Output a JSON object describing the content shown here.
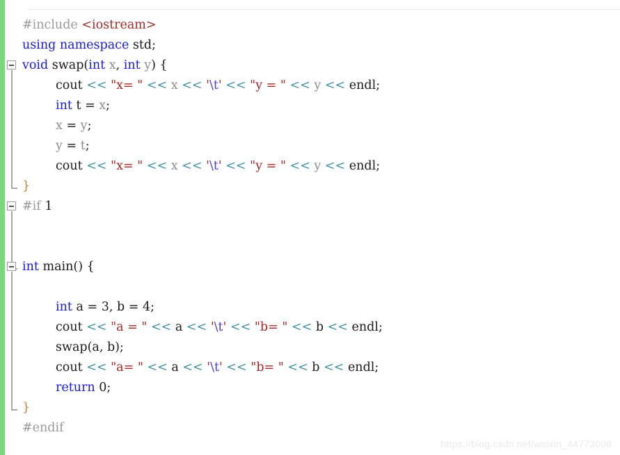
{
  "window": {
    "kind": "code-editor",
    "language": "C++",
    "background": "#ffffff"
  },
  "colors": {
    "change_bar_green": "#7ad87a",
    "preprocessor_gray": "#9a9a9a",
    "include_target_red": "#9c2b2b",
    "keyword_blue": "#1b1bd6",
    "identifier_black": "#1a1a1a",
    "variable_gray": "#8c8c8c",
    "stream_operator_teal": "#3e8fa3",
    "string_red": "#a32626",
    "escape_violet": "#4a3fd0",
    "brace_orange": "#c08030",
    "fold_marker_gray": "#9a9a9a",
    "watermark_gray": "#eaeaea"
  },
  "gutter": {
    "fold_markers": [
      {
        "name": "fold-marker-swap",
        "line": 3,
        "state": "expanded",
        "glyph": "minus"
      },
      {
        "name": "fold-marker-if",
        "line": 9,
        "state": "expanded",
        "glyph": "minus"
      },
      {
        "name": "fold-marker-main",
        "line": 12,
        "state": "expanded",
        "glyph": "minus"
      }
    ]
  },
  "code": {
    "lines": [
      {
        "index": 1,
        "indent": 0,
        "tokens": [
          {
            "t": "#include ",
            "c": "tok-pre"
          },
          {
            "t": "<iostream>",
            "c": "tok-inc"
          }
        ]
      },
      {
        "index": 2,
        "indent": 0,
        "tokens": [
          {
            "t": "using namespace",
            "c": "tok-kw"
          },
          {
            "t": " std;",
            "c": "tok-plain"
          }
        ]
      },
      {
        "index": 3,
        "indent": 0,
        "tokens": [
          {
            "t": "void",
            "c": "tok-kw"
          },
          {
            "t": " swap(",
            "c": "tok-plain"
          },
          {
            "t": "int",
            "c": "tok-kw"
          },
          {
            "t": " x",
            "c": "tok-var"
          },
          {
            "t": ", ",
            "c": "tok-plain"
          },
          {
            "t": "int",
            "c": "tok-kw"
          },
          {
            "t": " y",
            "c": "tok-var"
          },
          {
            "t": ") ",
            "c": "tok-plain"
          },
          {
            "t": "{",
            "c": "tok-plain"
          }
        ]
      },
      {
        "index": 4,
        "indent": 1,
        "tokens": [
          {
            "t": "cout ",
            "c": "tok-plain"
          },
          {
            "t": "<<",
            "c": "tok-op"
          },
          {
            "t": " ",
            "c": "tok-plain"
          },
          {
            "t": "\"x= \"",
            "c": "tok-str"
          },
          {
            "t": " ",
            "c": "tok-plain"
          },
          {
            "t": "<<",
            "c": "tok-op"
          },
          {
            "t": " x ",
            "c": "tok-var"
          },
          {
            "t": "<<",
            "c": "tok-op"
          },
          {
            "t": " ",
            "c": "tok-plain"
          },
          {
            "t": "'",
            "c": "tok-str"
          },
          {
            "t": "\\t",
            "c": "tok-esc"
          },
          {
            "t": "'",
            "c": "tok-str"
          },
          {
            "t": " ",
            "c": "tok-plain"
          },
          {
            "t": "<<",
            "c": "tok-op"
          },
          {
            "t": " ",
            "c": "tok-plain"
          },
          {
            "t": "\"y = \"",
            "c": "tok-str"
          },
          {
            "t": " ",
            "c": "tok-plain"
          },
          {
            "t": "<<",
            "c": "tok-op"
          },
          {
            "t": " y ",
            "c": "tok-var"
          },
          {
            "t": "<<",
            "c": "tok-op"
          },
          {
            "t": " endl;",
            "c": "tok-plain"
          }
        ]
      },
      {
        "index": 5,
        "indent": 1,
        "tokens": [
          {
            "t": "int",
            "c": "tok-kw"
          },
          {
            "t": " t = ",
            "c": "tok-plain"
          },
          {
            "t": "x",
            "c": "tok-var"
          },
          {
            "t": ";",
            "c": "tok-plain"
          }
        ]
      },
      {
        "index": 6,
        "indent": 1,
        "tokens": [
          {
            "t": "x ",
            "c": "tok-var"
          },
          {
            "t": "= ",
            "c": "tok-plain"
          },
          {
            "t": "y",
            "c": "tok-var"
          },
          {
            "t": ";",
            "c": "tok-plain"
          }
        ]
      },
      {
        "index": 7,
        "indent": 1,
        "tokens": [
          {
            "t": "y ",
            "c": "tok-var"
          },
          {
            "t": "= ",
            "c": "tok-plain"
          },
          {
            "t": "t",
            "c": "tok-var"
          },
          {
            "t": ";",
            "c": "tok-plain"
          }
        ]
      },
      {
        "index": 8,
        "indent": 1,
        "tokens": [
          {
            "t": "cout ",
            "c": "tok-plain"
          },
          {
            "t": "<<",
            "c": "tok-op"
          },
          {
            "t": " ",
            "c": "tok-plain"
          },
          {
            "t": "\"x= \"",
            "c": "tok-str"
          },
          {
            "t": " ",
            "c": "tok-plain"
          },
          {
            "t": "<<",
            "c": "tok-op"
          },
          {
            "t": " x ",
            "c": "tok-var"
          },
          {
            "t": "<<",
            "c": "tok-op"
          },
          {
            "t": " ",
            "c": "tok-plain"
          },
          {
            "t": "'",
            "c": "tok-str"
          },
          {
            "t": "\\t",
            "c": "tok-esc"
          },
          {
            "t": "'",
            "c": "tok-str"
          },
          {
            "t": " ",
            "c": "tok-plain"
          },
          {
            "t": "<<",
            "c": "tok-op"
          },
          {
            "t": " ",
            "c": "tok-plain"
          },
          {
            "t": "\"y = \"",
            "c": "tok-str"
          },
          {
            "t": " ",
            "c": "tok-plain"
          },
          {
            "t": "<<",
            "c": "tok-op"
          },
          {
            "t": " y ",
            "c": "tok-var"
          },
          {
            "t": "<<",
            "c": "tok-op"
          },
          {
            "t": " endl;",
            "c": "tok-plain"
          }
        ]
      },
      {
        "index": 9,
        "indent": 0,
        "tokens": [
          {
            "t": "}",
            "c": "tok-brace"
          }
        ]
      },
      {
        "index": 10,
        "indent": 0,
        "tokens": [
          {
            "t": "#if ",
            "c": "tok-pre"
          },
          {
            "t": "1",
            "c": "tok-num"
          }
        ]
      },
      {
        "index": 11,
        "indent": 0,
        "tokens": []
      },
      {
        "index": 12,
        "indent": 0,
        "tokens": []
      },
      {
        "index": 13,
        "indent": 0,
        "tokens": [
          {
            "t": "int",
            "c": "tok-kw"
          },
          {
            "t": " main() ",
            "c": "tok-plain"
          },
          {
            "t": "{",
            "c": "tok-plain"
          }
        ]
      },
      {
        "index": 14,
        "indent": 0,
        "tokens": []
      },
      {
        "index": 15,
        "indent": 1,
        "tokens": [
          {
            "t": "int",
            "c": "tok-kw"
          },
          {
            "t": " a = ",
            "c": "tok-plain"
          },
          {
            "t": "3",
            "c": "tok-num"
          },
          {
            "t": ", b = ",
            "c": "tok-plain"
          },
          {
            "t": "4",
            "c": "tok-num"
          },
          {
            "t": ";",
            "c": "tok-plain"
          }
        ]
      },
      {
        "index": 16,
        "indent": 1,
        "tokens": [
          {
            "t": "cout ",
            "c": "tok-plain"
          },
          {
            "t": "<<",
            "c": "tok-op"
          },
          {
            "t": " ",
            "c": "tok-plain"
          },
          {
            "t": "\"a = \"",
            "c": "tok-str"
          },
          {
            "t": " ",
            "c": "tok-plain"
          },
          {
            "t": "<<",
            "c": "tok-op"
          },
          {
            "t": " a ",
            "c": "tok-plain"
          },
          {
            "t": "<<",
            "c": "tok-op"
          },
          {
            "t": " ",
            "c": "tok-plain"
          },
          {
            "t": "'",
            "c": "tok-str"
          },
          {
            "t": "\\t",
            "c": "tok-esc"
          },
          {
            "t": "'",
            "c": "tok-str"
          },
          {
            "t": " ",
            "c": "tok-plain"
          },
          {
            "t": "<<",
            "c": "tok-op"
          },
          {
            "t": " ",
            "c": "tok-plain"
          },
          {
            "t": "\"b= \"",
            "c": "tok-str"
          },
          {
            "t": " ",
            "c": "tok-plain"
          },
          {
            "t": "<<",
            "c": "tok-op"
          },
          {
            "t": " b ",
            "c": "tok-plain"
          },
          {
            "t": "<<",
            "c": "tok-op"
          },
          {
            "t": " endl;",
            "c": "tok-plain"
          }
        ]
      },
      {
        "index": 17,
        "indent": 1,
        "tokens": [
          {
            "t": "swap(a, b);",
            "c": "tok-plain"
          }
        ]
      },
      {
        "index": 18,
        "indent": 1,
        "tokens": [
          {
            "t": "cout ",
            "c": "tok-plain"
          },
          {
            "t": "<<",
            "c": "tok-op"
          },
          {
            "t": " ",
            "c": "tok-plain"
          },
          {
            "t": "\"a= \"",
            "c": "tok-str"
          },
          {
            "t": " ",
            "c": "tok-plain"
          },
          {
            "t": "<<",
            "c": "tok-op"
          },
          {
            "t": " a ",
            "c": "tok-plain"
          },
          {
            "t": "<<",
            "c": "tok-op"
          },
          {
            "t": " ",
            "c": "tok-plain"
          },
          {
            "t": "'",
            "c": "tok-str"
          },
          {
            "t": "\\t",
            "c": "tok-esc"
          },
          {
            "t": "'",
            "c": "tok-str"
          },
          {
            "t": " ",
            "c": "tok-plain"
          },
          {
            "t": "<<",
            "c": "tok-op"
          },
          {
            "t": " ",
            "c": "tok-plain"
          },
          {
            "t": "\"b= \"",
            "c": "tok-str"
          },
          {
            "t": " ",
            "c": "tok-plain"
          },
          {
            "t": "<<",
            "c": "tok-op"
          },
          {
            "t": " b ",
            "c": "tok-plain"
          },
          {
            "t": "<<",
            "c": "tok-op"
          },
          {
            "t": " endl;",
            "c": "tok-plain"
          }
        ]
      },
      {
        "index": 19,
        "indent": 1,
        "tokens": [
          {
            "t": "return",
            "c": "tok-kw"
          },
          {
            "t": " ",
            "c": "tok-plain"
          },
          {
            "t": "0",
            "c": "tok-num"
          },
          {
            "t": ";",
            "c": "tok-plain"
          }
        ]
      },
      {
        "index": 20,
        "indent": 0,
        "tokens": [
          {
            "t": "}",
            "c": "tok-brace"
          }
        ]
      },
      {
        "index": 21,
        "indent": 0,
        "tokens": [
          {
            "t": "#endif",
            "c": "tok-pre"
          }
        ]
      }
    ]
  },
  "watermark": {
    "text": "https://blog.csdn.net/weixin_44773006"
  }
}
